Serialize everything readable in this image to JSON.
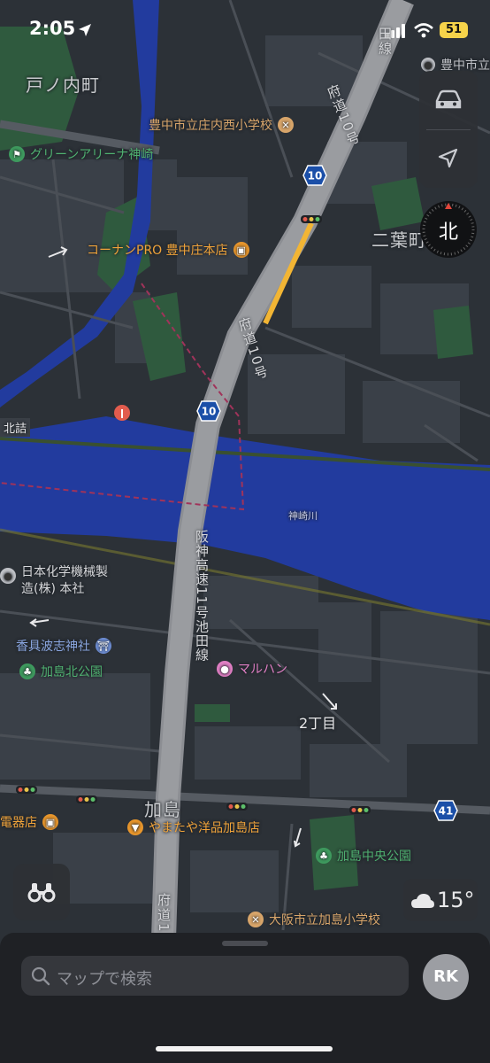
{
  "status_bar": {
    "time": "2:05",
    "battery": "51"
  },
  "map": {
    "areas": [
      "戸ノ内町",
      "二葉町",
      "加島",
      "2丁目"
    ],
    "roads": {
      "prefectural_10_upper": "府道10号",
      "prefectural_10_mid": "府道10号",
      "prefectural_1_lower": "府道1",
      "hanshin_expressway": "阪神高速11号池田線",
      "line_fragment": "田線"
    },
    "route_shields": [
      "10",
      "10",
      "41"
    ],
    "river": "神崎川",
    "edge_label": "北詰",
    "pois": [
      {
        "name": "豊中市立庄内西小学校",
        "icon": "school-icon",
        "color": "#d8a56a"
      },
      {
        "name": "グリーンアリーナ神崎",
        "icon": "sports-icon",
        "color": "#4fb070"
      },
      {
        "name": "コーナンPRO 豊中庄本店",
        "icon": "shopping-bag-icon",
        "color": "#f0a33a"
      },
      {
        "name": "豊中市立",
        "icon": "building-icon",
        "color": "#bfc1c6"
      },
      {
        "name": "日本化学機械製造(株) 本社",
        "icon": "building-icon",
        "color": "#bfc1c6"
      },
      {
        "name": "香具波志神社",
        "icon": "shrine-icon",
        "color": "#8aa6e0"
      },
      {
        "name": "加島北公園",
        "icon": "tree-icon",
        "color": "#4fb070"
      },
      {
        "name": "マルハン",
        "icon": "entertainment-icon",
        "color": "#e07fc4"
      },
      {
        "name": "電器店",
        "icon": "shopping-bag-icon",
        "color": "#f0a33a"
      },
      {
        "name": "やまたや洋品加島店",
        "icon": "clothing-icon",
        "color": "#f0a33a"
      },
      {
        "name": "加島中央公園",
        "icon": "tree-icon",
        "color": "#4fb070"
      },
      {
        "name": "大阪市立加島小学校",
        "icon": "school-icon",
        "color": "#d8a56a"
      }
    ]
  },
  "controls": {
    "compass_label": "北",
    "weather_temp": "15°"
  },
  "search": {
    "placeholder": "マップで検索",
    "avatar_initials": "RK"
  },
  "colors": {
    "river": "#223b9e",
    "land": "#2c3137",
    "park": "#2f5a3e",
    "building": "#3d434b",
    "expressway": "#8c8e93",
    "road": "#54585f",
    "traffic": "#f2b534"
  }
}
